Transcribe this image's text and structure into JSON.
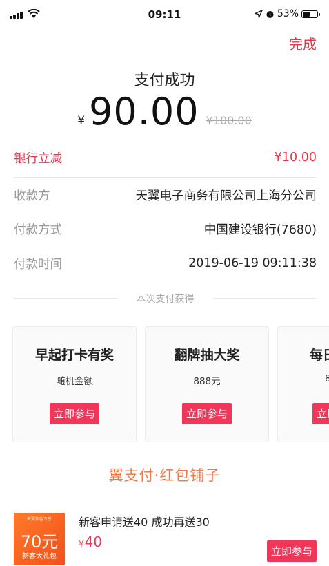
{
  "status_bar": {
    "time": "09:11",
    "battery_percent": "53%",
    "battery_level": 0.53
  },
  "header": {
    "done_label": "完成"
  },
  "payment": {
    "title": "支付成功",
    "currency_symbol": "¥",
    "amount": "90.00",
    "original_amount": "¥100.00"
  },
  "details": {
    "discount": {
      "label": "银行立减",
      "value": "¥10.00"
    },
    "payee": {
      "label": "收款方",
      "value": "天翼电子商务有限公司上海分公司"
    },
    "method": {
      "label": "付款方式",
      "value": "中国建设银行(7680)"
    },
    "time": {
      "label": "付款时间",
      "value": "2019-06-19 09:11:38"
    }
  },
  "rewards": {
    "divider_text": "本次支付获得",
    "cards": [
      {
        "title": "早起打卡有奖",
        "subtitle": "随机金额",
        "button": "立即参与"
      },
      {
        "title": "翻牌抽大奖",
        "subtitle": "888元",
        "button": "立即参与"
      },
      {
        "title": "每日",
        "subtitle": "8",
        "button": "立即"
      }
    ]
  },
  "shop": {
    "title": "翼支付·红包铺子",
    "item": {
      "image_top_text": "天翼新客专享",
      "image_big_text": "70元",
      "image_small_text": "新客大礼包",
      "title": "新客申请送40 成功再送30",
      "price_symbol": "¥",
      "price": "40",
      "button": "立即参与"
    }
  },
  "colors": {
    "accent": "#e8374d",
    "button_red": "#f0375a",
    "shop_title": "#f07a4a"
  }
}
